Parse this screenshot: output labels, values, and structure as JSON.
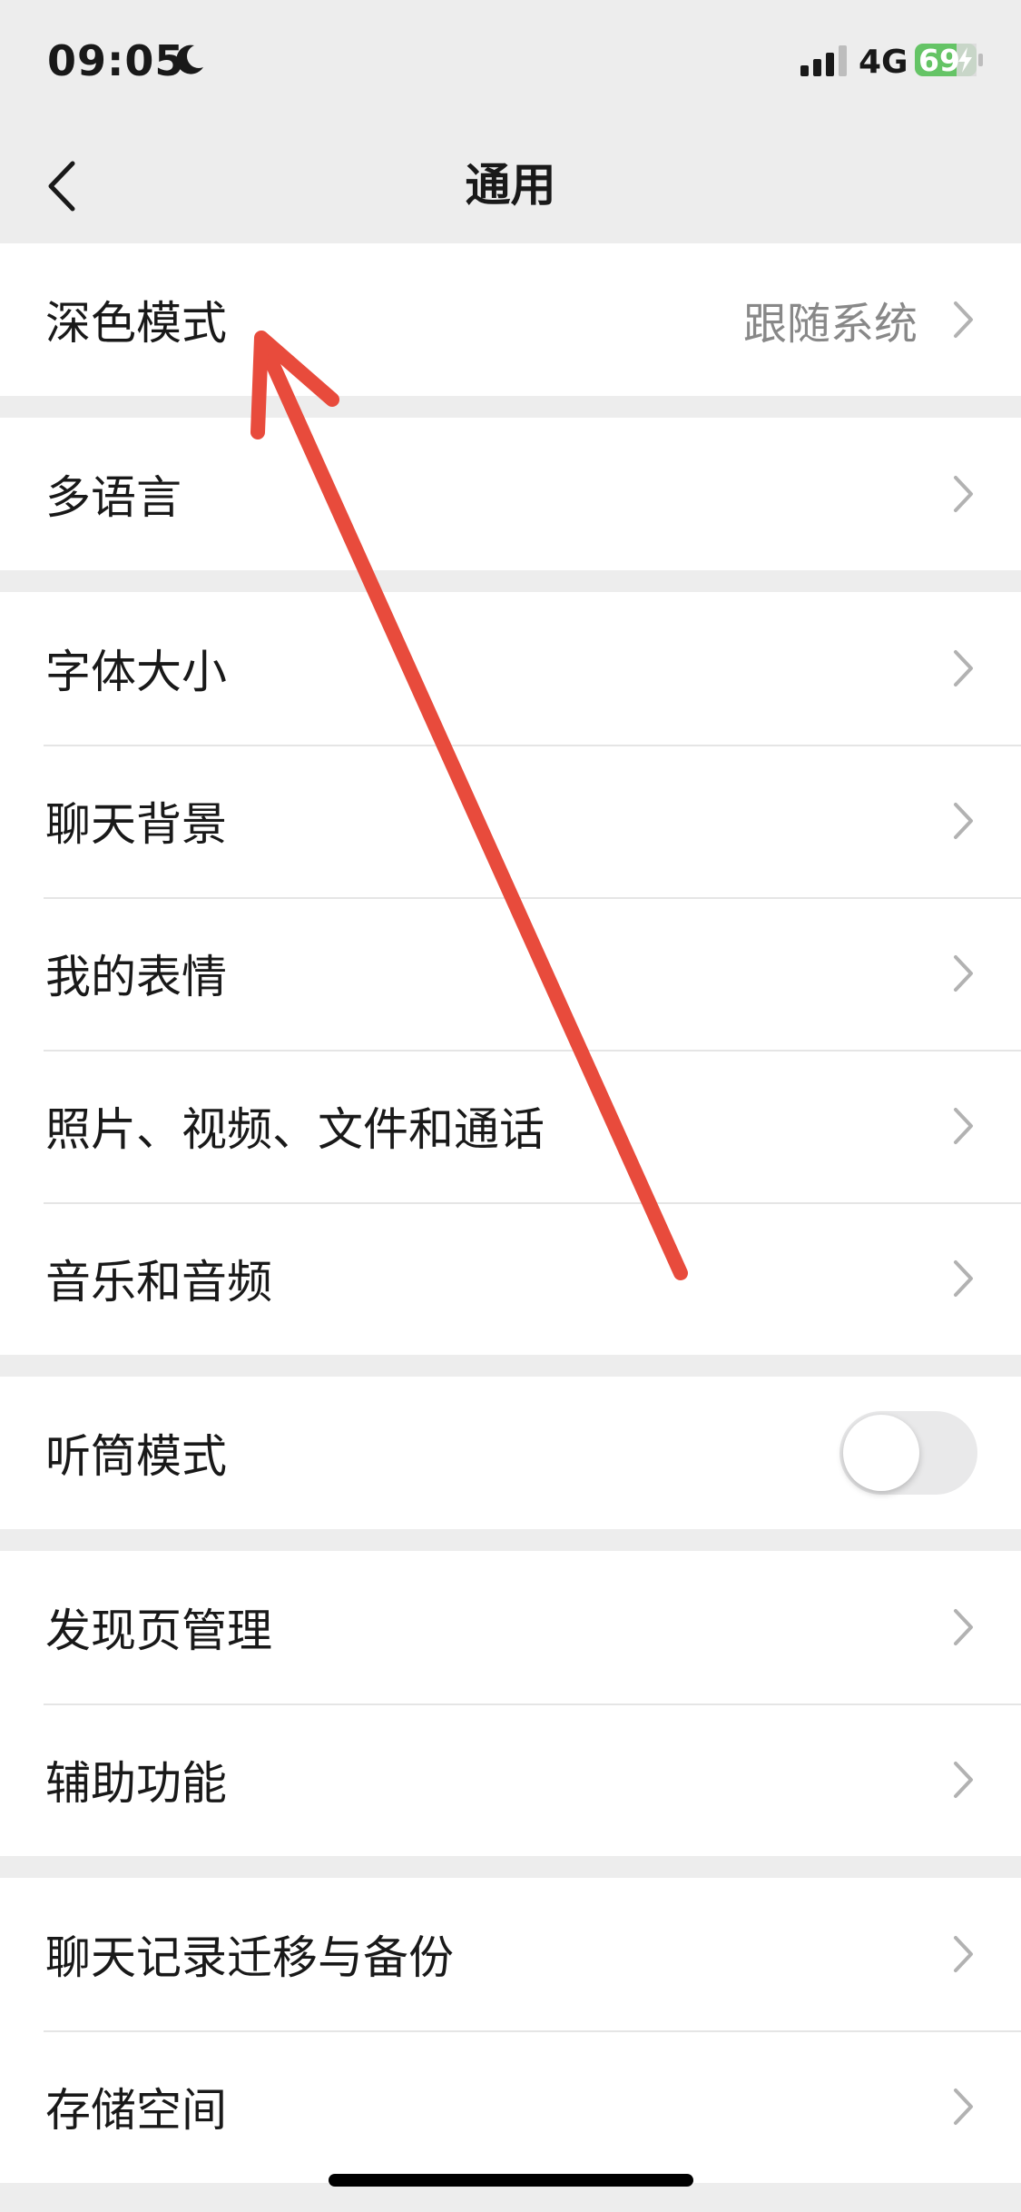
{
  "status_bar": {
    "time": "09:05",
    "network": "4G",
    "battery": "69",
    "icons": [
      "moon-icon",
      "signal-icon",
      "battery-icon",
      "charging-bolt-icon"
    ]
  },
  "nav": {
    "title": "通用",
    "back_icon": "chevron-left-icon"
  },
  "groups": [
    {
      "rows": [
        {
          "label": "深色模式",
          "value": "跟随系统"
        }
      ]
    },
    {
      "rows": [
        {
          "label": "多语言"
        }
      ]
    },
    {
      "rows": [
        {
          "label": "字体大小"
        },
        {
          "label": "聊天背景"
        },
        {
          "label": "我的表情"
        },
        {
          "label": "照片、视频、文件和通话"
        },
        {
          "label": "音乐和音频"
        }
      ]
    },
    {
      "rows": [
        {
          "label": "听筒模式",
          "toggle": false
        }
      ]
    },
    {
      "rows": [
        {
          "label": "发现页管理"
        },
        {
          "label": "辅助功能"
        }
      ]
    },
    {
      "rows": [
        {
          "label": "聊天记录迁移与备份"
        },
        {
          "label": "存储空间"
        }
      ]
    }
  ],
  "colors": {
    "background": "#ededed",
    "row_background": "#ffffff",
    "annotation_arrow": "#e84b3c",
    "battery_fill": "#65c466"
  }
}
